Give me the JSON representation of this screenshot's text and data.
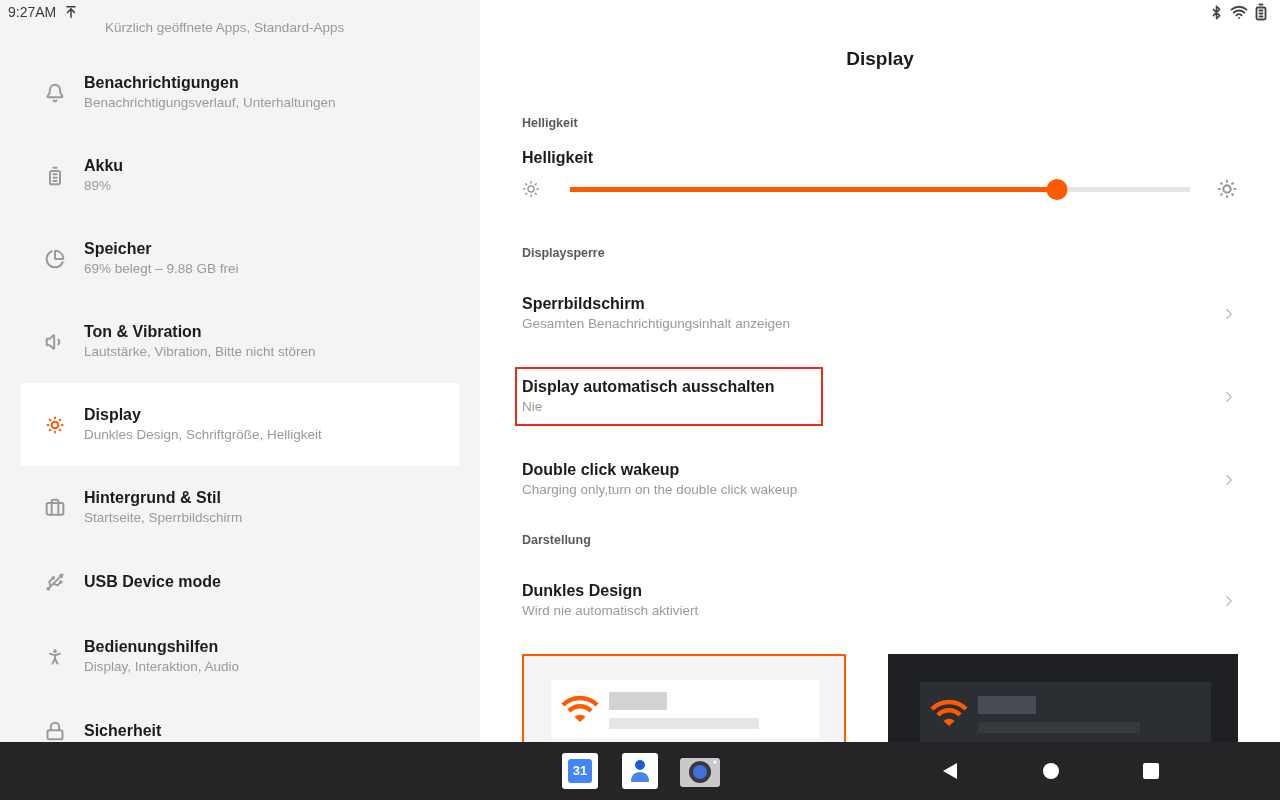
{
  "status_bar": {
    "time": "9:27AM"
  },
  "sidebar": {
    "clipped_subtitle": "Kürzlich geöffnete Apps, Standard-Apps",
    "items": [
      {
        "kind": "bell",
        "title": "Benachrichtigungen",
        "subtitle": "Benachrichtigungsverlauf, Unterhaltungen",
        "selected": false
      },
      {
        "kind": "battery",
        "title": "Akku",
        "subtitle": "89%",
        "selected": false
      },
      {
        "kind": "storage",
        "title": "Speicher",
        "subtitle": "69% belegt – 9.88 GB frei",
        "selected": false
      },
      {
        "kind": "sound",
        "title": "Ton & Vibration",
        "subtitle": "Lautstärke, Vibration, Bitte nicht stören",
        "selected": false
      },
      {
        "kind": "display",
        "title": "Display",
        "subtitle": "Dunkles Design, Schriftgröße, Helligkeit",
        "selected": true
      },
      {
        "kind": "wallpaper",
        "title": "Hintergrund & Stil",
        "subtitle": "Startseite, Sperrbildschirm",
        "selected": false
      },
      {
        "kind": "usb",
        "title": "USB Device mode",
        "selected": false
      },
      {
        "kind": "accessibility",
        "title": "Bedienungshilfen",
        "subtitle": "Display, Interaktion, Audio",
        "selected": false
      },
      {
        "kind": "security",
        "title": "Sicherheit",
        "selected": false
      }
    ]
  },
  "page": {
    "title": "Display",
    "sections": [
      {
        "label": "Helligkeit",
        "items": [
          {
            "kind": "slider",
            "title": "Helligkeit",
            "level": 0.785
          }
        ]
      },
      {
        "label": "Displaysperre",
        "items": [
          {
            "kind": "link",
            "title": "Sperrbildschirm",
            "subtitle": "Gesamten Benachrichtigungsinhalt anzeigen",
            "highlighted": false
          },
          {
            "kind": "link",
            "title": "Display automatisch ausschalten",
            "subtitle": "Nie",
            "highlighted": true
          },
          {
            "kind": "link",
            "title": "Double click wakeup",
            "subtitle": "Charging only,turn on the double click wakeup",
            "highlighted": false
          }
        ]
      },
      {
        "label": "Darstellung",
        "items": [
          {
            "kind": "link",
            "title": "Dunkles Design",
            "subtitle": "Wird nie automatisch aktiviert",
            "highlighted": false
          },
          {
            "kind": "themes",
            "themes": [
              {
                "kind": "light",
                "selected": true
              },
              {
                "kind": "dark",
                "selected": false
              }
            ]
          }
        ]
      }
    ]
  },
  "dock": {
    "calendar_day": "31"
  }
}
